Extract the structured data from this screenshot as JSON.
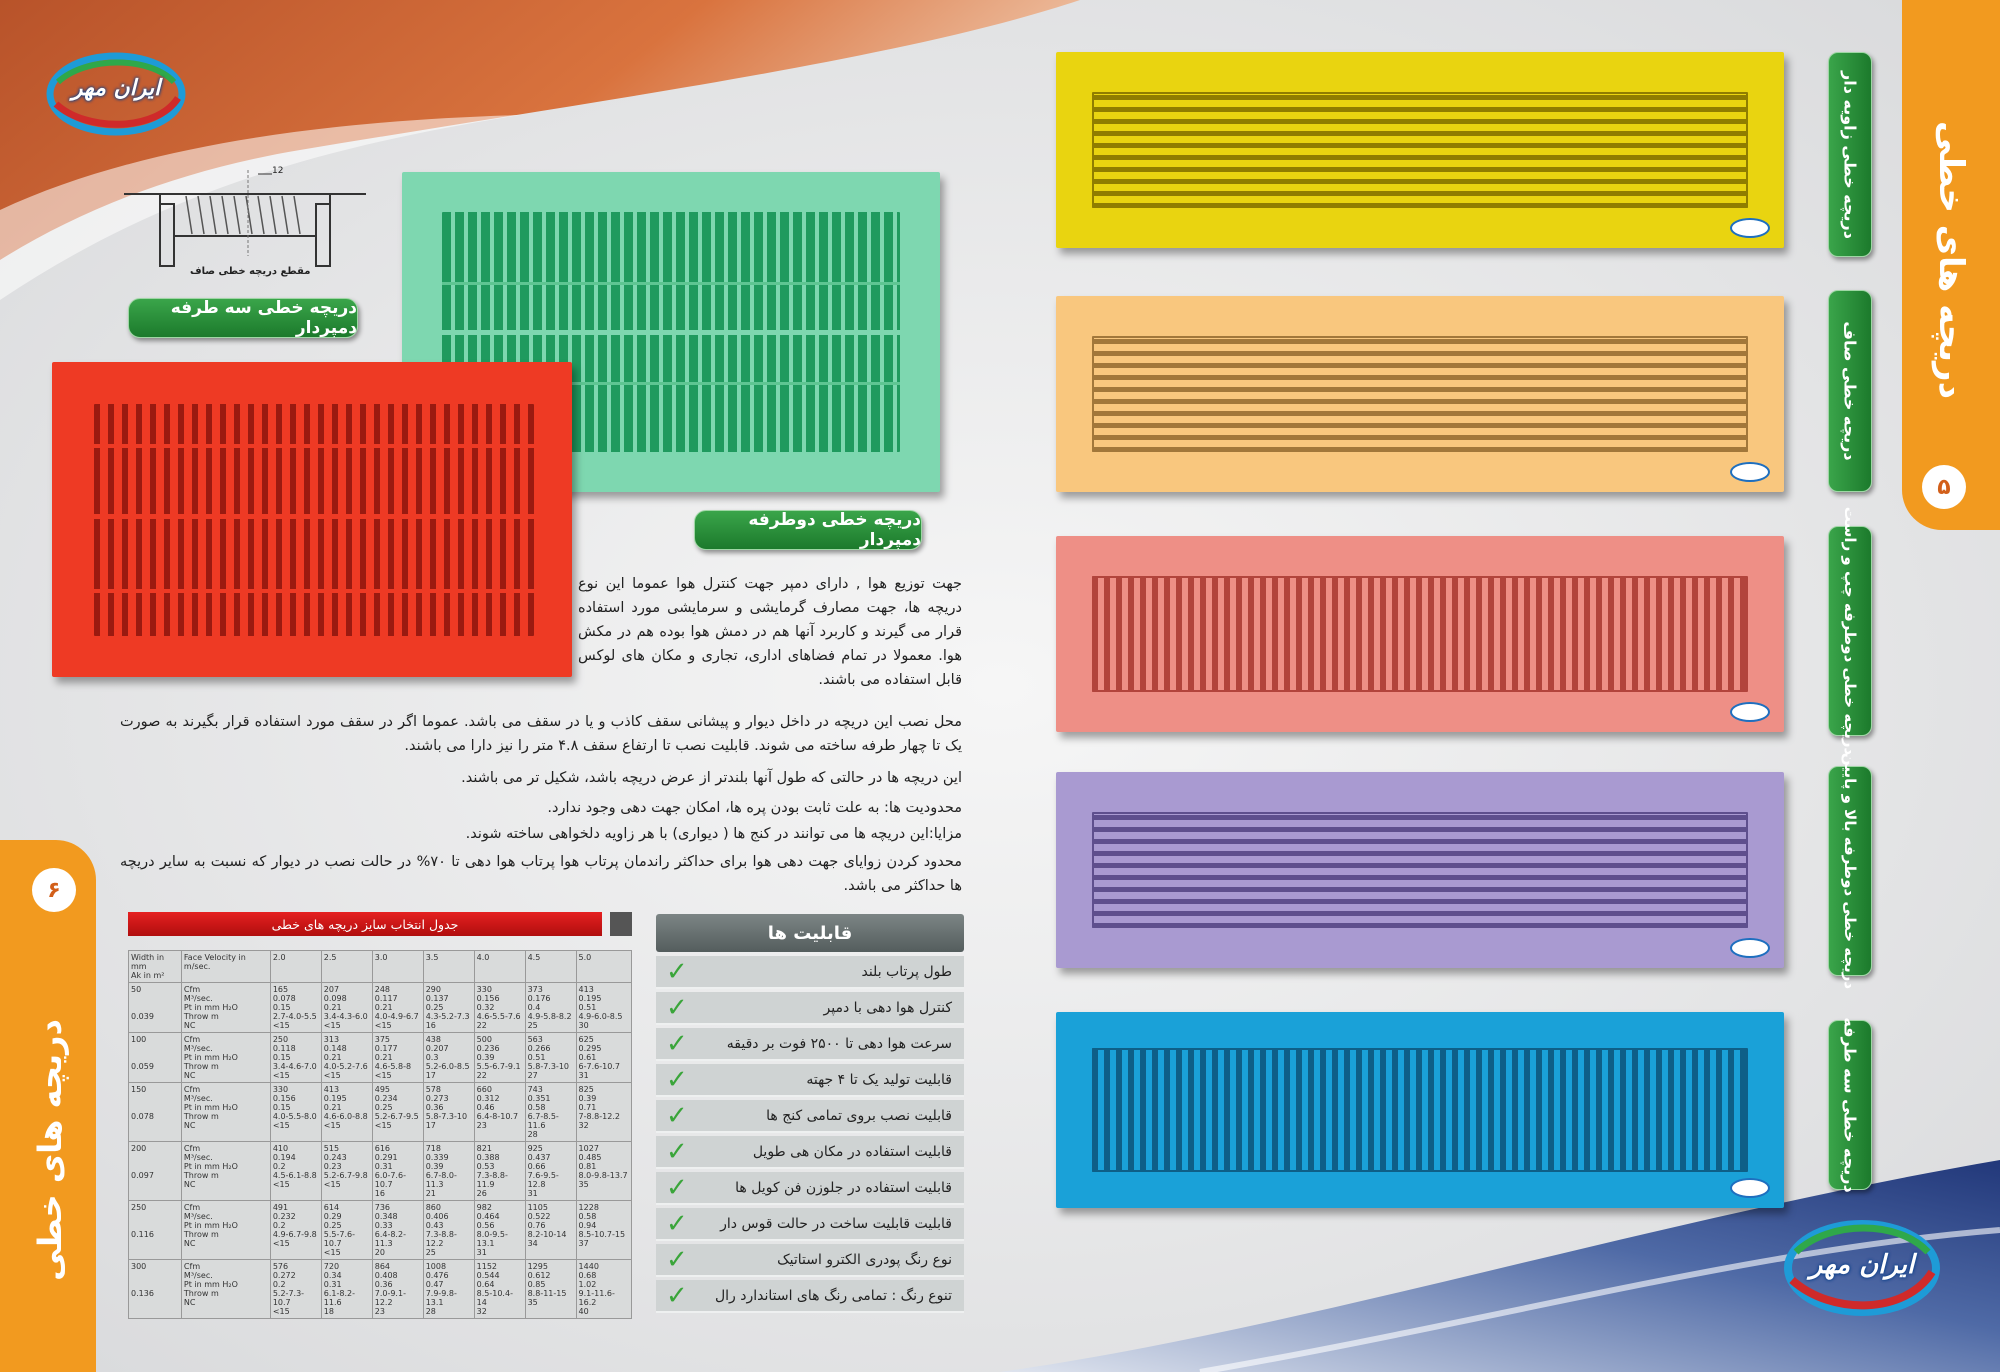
{
  "brand": {
    "logo_text": "ایران مهر"
  },
  "right_page": {
    "section_title": "دریچه های خطی",
    "page_number": "۵",
    "products": [
      {
        "label": "دریچه خطی زاویه دار",
        "color": "#e9d410"
      },
      {
        "label": "دریچه خطی صاف",
        "color": "#f9c77e"
      },
      {
        "label": "دریچه خطی دوطرفه چپ و راست",
        "color": "#ee8f86"
      },
      {
        "label": "دریچه خطی دوطرفه بالا و پایین",
        "color": "#a99ad1"
      },
      {
        "label": "دریچه خطی سه طرفه",
        "color": "#1aa1d8"
      }
    ]
  },
  "left_page": {
    "section_title": "دریچه های خطی",
    "page_number": "۶",
    "diagram_caption": "مقطع دریچه خطی صاف",
    "diagram_dimension": "12",
    "label_three_way": "دریچه خطی سه طرفه دمپردار",
    "label_two_way": "دریچه خطی دوطرفه دمپردار",
    "paragraphs": [
      "جهت توزیع هوا , دارای دمپر جهت کنترل هوا عموما این نوع دریچه ها، جهت مصارف گرمایشی و سرمایشی مورد استفاده قرار می گیرند و کاربرد آنها هم در دمش هوا بوده هم در مکش هوا. معمولا در تمام فضاهای اداری، تجاری و مکان های لوکس قابل استفاده می باشند.",
      "محل نصب این دریچه در داخل دیوار و پیشانی سقف کاذب و یا در سقف می باشد. عموما اگر در سقف مورد استفاده قرار بگیرند به صورت یک تا چهار طرفه ساخته می شوند. قابلیت نصب تا ارتفاع سقف ۴.۸ متر را نیز دارا می باشند.",
      "این دریچه ها در حالتی که طول آنها بلندتر از عرض دریچه باشد، شکیل تر می باشند.",
      "محدودیت ها: به علت ثابت بودن پره ها، امکان جهت دهی وجود ندارد.",
      "مزایا:این دریچه ها می توانند در کنج ها ( دیواری) با هر زاویه دلخواهی ساخته شوند.",
      "محدود کردن زوایای جهت دهی هوا برای حداکثر راندمان پرتاب هوا پرتاب هوا دهی تا ۷۰% در حالت نصب در دیوار که نسبت به سایر دریچه ها حداکثر می باشد."
    ],
    "features_title": "قابلیت ها",
    "features": [
      "طول پرتاب بلند",
      "کنترل هوا دهی با دمپر",
      "سرعت هوا دهی تا ۲۵۰۰ فوت بر دقیقه",
      "قابلیت تولید یک تا ۴ جهته",
      "قابلیت نصب بروی تمامی کنج ها",
      "قابلیت استفاده در مکان هی طویل",
      "قابلیت استفاده در جلوزن فن کویل ها",
      "قابلیت قابلیت ساخت در حالت قوس دار",
      "نوع رنگ پودری الکترو استاتیک",
      "تنوع رنگ : تمامی رنگ های استاندارد رال"
    ],
    "table_title": "جدول انتخاب سایز دریچه های خطی",
    "table": {
      "corner": "Width in mm\nAk in m²",
      "param_header": "Face Velocity in m/sec.",
      "velocities": [
        "2.0",
        "2.5",
        "3.0",
        "3.5",
        "4.0",
        "4.5",
        "5.0"
      ],
      "param_labels": "Cfm\nM³/sec.\nPt in mm H₂O\nThrow m\nNC",
      "rows": [
        {
          "width": "50",
          "ak": "0.039",
          "cells": [
            "165\n0.078\n0.15\n2.7-4.0-5.5\n<15",
            "207\n0.098\n0.21\n3.4-4.3-6.0\n<15",
            "248\n0.117\n0.21\n4.0-4.9-6.7\n<15",
            "290\n0.137\n0.25\n4.3-5.2-7.3\n16",
            "330\n0.156\n0.32\n4.6-5.5-7.6\n22",
            "373\n0.176\n0.4\n4.9-5.8-8.2\n25",
            "413\n0.195\n0.51\n4.9-6.0-8.5\n30"
          ]
        },
        {
          "width": "100",
          "ak": "0.059",
          "cells": [
            "250\n0.118\n0.15\n3.4-4.6-7.0\n<15",
            "313\n0.148\n0.21\n4.0-5.2-7.6\n<15",
            "375\n0.177\n0.21\n4.6-5.8-8\n<15",
            "438\n0.207\n0.3\n5.2-6.0-8.5\n17",
            "500\n0.236\n0.39\n5.5-6.7-9.1\n22",
            "563\n0.266\n0.51\n5.8-7.3-10\n27",
            "625\n0.295\n0.61\n6-7.6-10.7\n31"
          ]
        },
        {
          "width": "150",
          "ak": "0.078",
          "cells": [
            "330\n0.156\n0.15\n4.0-5.5-8.0\n<15",
            "413\n0.195\n0.21\n4.6-6.0-8.8\n<15",
            "495\n0.234\n0.25\n5.2-6.7-9.5\n<15",
            "578\n0.273\n0.36\n5.8-7.3-10\n17",
            "660\n0.312\n0.46\n6.4-8-10.7\n23",
            "743\n0.351\n0.58\n6.7-8.5-11.6\n28",
            "825\n0.39\n0.71\n7-8.8-12.2\n32"
          ]
        },
        {
          "width": "200",
          "ak": "0.097",
          "cells": [
            "410\n0.194\n0.2\n4.5-6.1-8.8\n<15",
            "515\n0.243\n0.23\n5.2-6.7-9.8\n<15",
            "616\n0.291\n0.31\n6.0-7.6-10.7\n16",
            "718\n0.339\n0.39\n6.7-8.0-11.3\n21",
            "821\n0.388\n0.53\n7.3-8.8-11.9\n26",
            "925\n0.437\n0.66\n7.6-9.5-12.8\n31",
            "1027\n0.485\n0.81\n8.0-9.8-13.7\n35"
          ]
        },
        {
          "width": "250",
          "ak": "0.116",
          "cells": [
            "491\n0.232\n0.2\n4.9-6.7-9.8\n<15",
            "614\n0.29\n0.25\n5.5-7.6-10.7\n<15",
            "736\n0.348\n0.33\n6.4-8.2-11.3\n20",
            "860\n0.406\n0.43\n7.3-8.8-12.2\n25",
            "982\n0.464\n0.56\n8.0-9.5-13.1\n31",
            "1105\n0.522\n0.76\n8.2-10-14\n34",
            "1228\n0.58\n0.94\n8.5-10.7-15\n37"
          ]
        },
        {
          "width": "300",
          "ak": "0.136",
          "cells": [
            "576\n0.272\n0.2\n5.2-7.3-10.7\n<15",
            "720\n0.34\n0.31\n6.1-8.2-11.6\n18",
            "864\n0.408\n0.36\n7.0-9.1-12.2\n23",
            "1008\n0.476\n0.47\n7.9-9.8-13.1\n28",
            "1152\n0.544\n0.64\n8.5-10.4-14\n32",
            "1295\n0.612\n0.85\n8.8-11-15\n35",
            "1440\n0.68\n1.02\n9.1-11.6-16.2\n40"
          ]
        }
      ]
    }
  }
}
